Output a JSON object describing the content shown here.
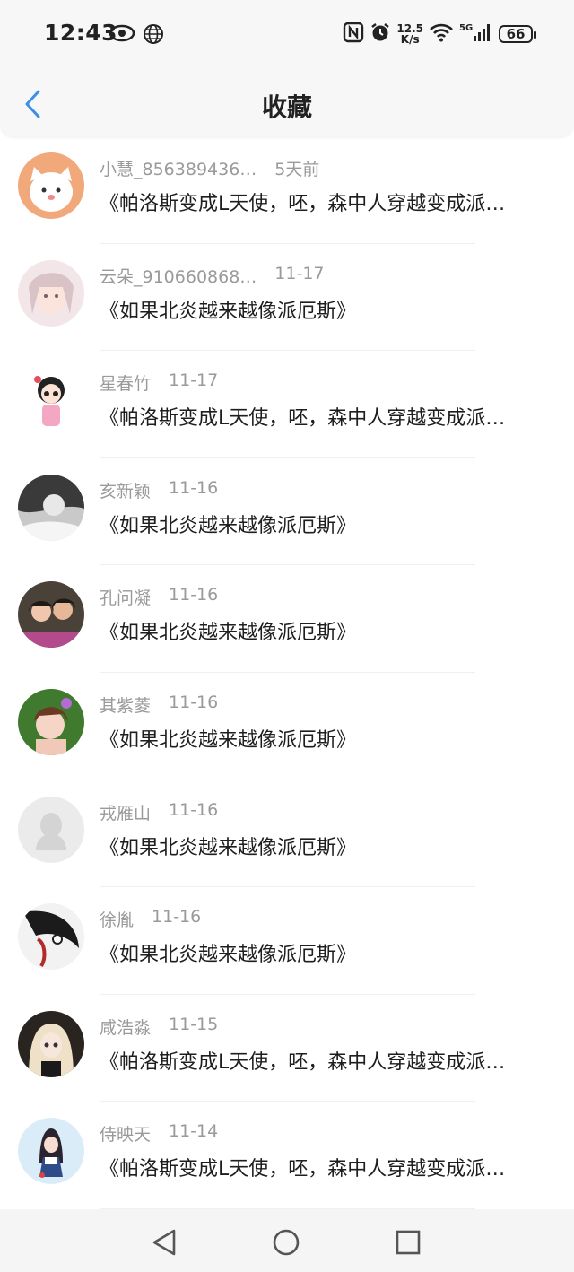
{
  "status": {
    "time": "12:43",
    "speed_value": "12.5",
    "speed_unit": "K/s",
    "battery": "66",
    "icons": [
      "eye-icon",
      "globe-icon",
      "nfc-icon",
      "alarm-icon",
      "wifi-icon",
      "signal-5g-icon",
      "battery-icon"
    ]
  },
  "header": {
    "title": "收藏",
    "back_icon": "chevron-left-icon"
  },
  "items": [
    {
      "name": "小慧_856389436…",
      "time": "5天前",
      "text": "《帕洛斯变成L天使，呸，森中人穿越变成派…"
    },
    {
      "name": "云朵_910660868…",
      "time": "11-17",
      "text": "《如果北炎越来越像派厄斯》"
    },
    {
      "name": "星春竹",
      "time": "11-17",
      "text": "《帕洛斯变成L天使，呸，森中人穿越变成派…"
    },
    {
      "name": "亥新颖",
      "time": "11-16",
      "text": "《如果北炎越来越像派厄斯》"
    },
    {
      "name": "孔问凝",
      "time": "11-16",
      "text": "《如果北炎越来越像派厄斯》"
    },
    {
      "name": "其紫菱",
      "time": "11-16",
      "text": "《如果北炎越来越像派厄斯》"
    },
    {
      "name": "戎雁山",
      "time": "11-16",
      "text": "《如果北炎越来越像派厄斯》"
    },
    {
      "name": "徐胤",
      "time": "11-16",
      "text": "《如果北炎越来越像派厄斯》"
    },
    {
      "name": "咸浩淼",
      "time": "11-15",
      "text": "《帕洛斯变成L天使，呸，森中人穿越变成派…"
    },
    {
      "name": "侍映天",
      "time": "11-14",
      "text": "《帕洛斯变成L天使，呸，森中人穿越变成派…"
    }
  ],
  "nav": {
    "back": "triangle-back-icon",
    "home": "circle-home-icon",
    "recents": "square-recents-icon"
  },
  "colors": {
    "accent": "#3b8fe6",
    "secondary_text": "#9a9a9a"
  }
}
